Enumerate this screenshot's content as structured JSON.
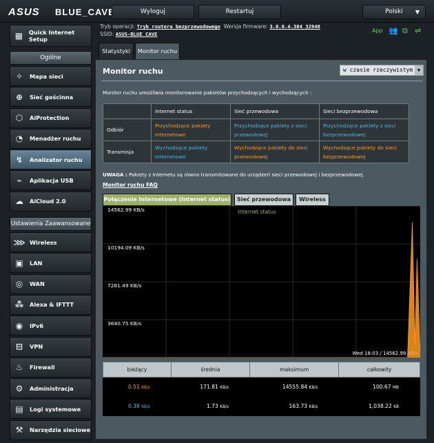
{
  "header": {
    "brand": "ASUS",
    "model": "BLUE_CAVE",
    "logout_label": "Wyloguj",
    "restart_label": "Restartuj",
    "language": "Polski"
  },
  "info": {
    "mode_label": "Tryb operacji:",
    "mode_value": "Tryb routera bezprzewodowego",
    "firmware_label": "Wersja firmware:",
    "firmware_value": "3.0.0.4.384_32948",
    "ssid_label": "SSID:",
    "ssid_value": "ASUS-BLUE_CAVE",
    "app_label": "App"
  },
  "sidebar": {
    "quick_setup": "Quick Internet Setup",
    "general_header": "Ogólne",
    "general_items": [
      {
        "label": "Mapa sieci",
        "icon": "network-map-icon"
      },
      {
        "label": "Sieć gościnna",
        "icon": "guest-network-icon"
      },
      {
        "label": "AiProtection",
        "icon": "aiprotection-icon"
      },
      {
        "label": "Menadżer ruchu",
        "icon": "traffic-manager-icon"
      },
      {
        "label": "Analizator ruchu",
        "icon": "traffic-analyzer-icon"
      },
      {
        "label": "Aplikacja USB",
        "icon": "usb-icon"
      },
      {
        "label": "AiCloud 2.0",
        "icon": "cloud-icon"
      }
    ],
    "advanced_header": "Ustawienia Zaawansowane",
    "advanced_items": [
      {
        "label": "Wireless",
        "icon": "wireless-icon"
      },
      {
        "label": "LAN",
        "icon": "lan-icon"
      },
      {
        "label": "WAN",
        "icon": "wan-icon"
      },
      {
        "label": "Alexa & IFTTT",
        "icon": "alexa-icon"
      },
      {
        "label": "IPv6",
        "icon": "ipv6-icon"
      },
      {
        "label": "VPN",
        "icon": "vpn-icon"
      },
      {
        "label": "Firewall",
        "icon": "firewall-icon"
      },
      {
        "label": "Administracja",
        "icon": "admin-icon"
      },
      {
        "label": "Logi systemowe",
        "icon": "logs-icon"
      },
      {
        "label": "Narzędzia sieciowe",
        "icon": "tools-icon"
      }
    ]
  },
  "tabs": {
    "stats": "Statystyki",
    "monitor": "Monitor ruchu"
  },
  "main": {
    "title": "Monitor ruchu",
    "mode_select": "w czasie rzeczywistym",
    "description": "Monitor ruchu umożliwia monitorowanie pakietów przychodzących i wychodzących :",
    "table": {
      "headers": [
        "",
        "Internet status",
        "Sieć przewodowa",
        "Sieci bezprzewodowa"
      ],
      "rows": [
        {
          "label": "Odbiór",
          "cells": [
            "Przychodzące pakiety Internetowe",
            "Przychodzące pakiety z sieci przewodowej",
            "Przychodzące pakiety z sieci bezprzewodowej"
          ],
          "colors": [
            "or",
            "bl",
            "bl"
          ]
        },
        {
          "label": "Transmisja",
          "cells": [
            "Wychodzące pakiety Internetowe",
            "Wychodzące pakiety do sieci przewodowej",
            "Wychodzące pakiety do sieci bezprzewodowej"
          ],
          "colors": [
            "bl",
            "or",
            "or"
          ]
        }
      ]
    },
    "note_label": "UWAGA :",
    "note_text": "Pakiety z Internetu są równo transmitowane do urządzeń sieci przewodowej i bezprzewodowej.",
    "faq": "Monitor ruchu FAQ"
  },
  "chart_tabs": [
    "Połączenie Internetowe (Internet status)",
    "Sieć przewodowa",
    "Wireless"
  ],
  "chart_data": {
    "type": "area",
    "title": "Internet status",
    "y_ticks": [
      "14562.99 KB/s",
      "10194.09 KB/s",
      "7281.49 KB/s",
      "3640.75 KB/s"
    ],
    "ylim": [
      0,
      14562.99
    ],
    "footer": "Wed 18:03 / 14562.99 KB/s",
    "series": [
      {
        "name": "rx",
        "color": "#ff9a1f",
        "points": [
          [
            0.0,
            0
          ],
          [
            0.96,
            0
          ],
          [
            0.975,
            13000
          ],
          [
            0.983,
            1200
          ],
          [
            0.99,
            9500
          ],
          [
            1.0,
            200
          ]
        ]
      }
    ]
  },
  "stats": {
    "headers": [
      "bieżący",
      "średnia",
      "maksimum",
      "całkowity"
    ],
    "rows": [
      {
        "values": [
          "0.51",
          "171.81",
          "14555.84",
          "100.67"
        ],
        "units": [
          "KB/s",
          "KB/s",
          "KB/s",
          "MB"
        ]
      },
      {
        "values": [
          "0.38",
          "1.73",
          "163.73",
          "1,038.22"
        ],
        "units": [
          "KB/s",
          "KB/s",
          "KB/s",
          "KB"
        ]
      }
    ]
  }
}
